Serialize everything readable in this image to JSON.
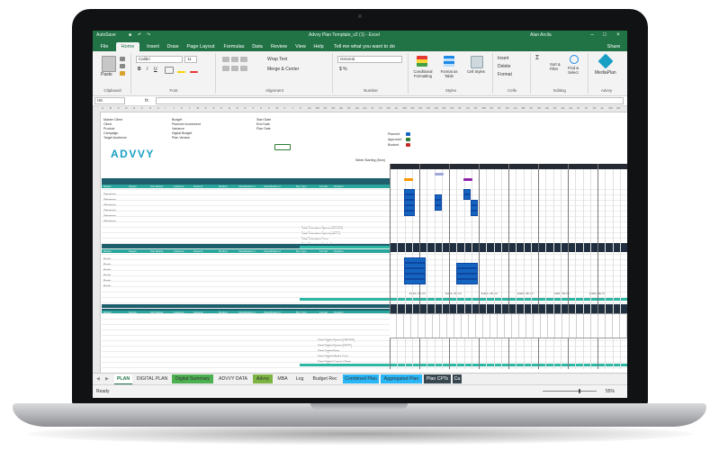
{
  "window": {
    "title": "Advvy Plan Template_v2 (1) - Excel",
    "user": "Alan Arcila",
    "autosave": "AutoSave"
  },
  "tabs": [
    "File",
    "Home",
    "Insert",
    "Draw",
    "Page Layout",
    "Formulas",
    "Data",
    "Review",
    "View",
    "Help",
    "Tell me what you want to do"
  ],
  "share": "Share",
  "ribbon": {
    "clipboard": {
      "paste": "Paste",
      "label": "Clipboard"
    },
    "font": {
      "name": "Calibri",
      "size": "11",
      "label": "Font"
    },
    "alignment": {
      "wrap": "Wrap Text",
      "merge": "Merge & Center",
      "label": "Alignment"
    },
    "number": {
      "format": "General",
      "label": "Number"
    },
    "styles": {
      "conditional": "Conditional Formatting",
      "table": "Format as Table",
      "cell": "Cell Styles",
      "label": "Styles"
    },
    "cells": {
      "insert": "Insert",
      "delete": "Delete",
      "format": "Format",
      "label": "Cells"
    },
    "editing": {
      "sort": "Sort & Filter",
      "find": "Find & Select",
      "label": "Editing"
    },
    "advvy": {
      "media": "MediaPlan",
      "label": "Advvy"
    }
  },
  "formula_bar": {
    "cell_ref": "H8",
    "fx": "fx",
    "value": ""
  },
  "sheet": {
    "logo": "ADVVY",
    "info_labels": [
      "Master Client",
      "Client",
      "Product",
      "Campaign",
      "Target Audience"
    ],
    "budget_labels": [
      "Budget",
      "Planned Investment",
      "Variance",
      "Digital Budget",
      "Plan Version"
    ],
    "date_labels": [
      "Start Date",
      "End Date",
      "Plan Date"
    ],
    "legend": [
      "Planned",
      "Approved",
      "Booked"
    ],
    "week_label": "Week Starting (Mon)",
    "sections": [
      "Network",
      "Radio",
      "OOH",
      "Digital"
    ],
    "col_headers": [
      "Market",
      "Region",
      "Sub Market",
      "Audience",
      "Network",
      "Medium",
      "Classification 1",
      "Classification 2",
      "Buy Type",
      "Format",
      "Duration"
    ],
    "rows_a": [
      "Television",
      "Television",
      "Television",
      "Television",
      "Television",
      "Television"
    ],
    "rows_b": [
      "Radio",
      "Radio",
      "Radio",
      "Radio",
      "Radio",
      "Radio"
    ],
    "totals": [
      "Total Television Spend (GROSS)",
      "Total Television Spend (NETT)",
      "Total Television Fees",
      "Total Television Media Cost",
      "Total Television Cost to Client"
    ],
    "totals_c": [
      "Total Digital Spend (GROSS)",
      "Total Digital Spend (NETT)",
      "Total Digital Fees",
      "Total Digital Media Cost",
      "Total Digital Cost to Client"
    ],
    "money": "$345,750.00"
  },
  "sheet_tabs": [
    {
      "label": "PLAN",
      "active": true,
      "color": "#ffffff"
    },
    {
      "label": "DIGITAL PLAN",
      "active": false,
      "color": "#f0f0f0"
    },
    {
      "label": "Digital Summary",
      "active": false,
      "color": "#4caf50"
    },
    {
      "label": "ADVVY DATA",
      "active": false,
      "color": "#f0f0f0"
    },
    {
      "label": "Advvy",
      "active": false,
      "color": "#7cb342"
    },
    {
      "label": "MBA",
      "active": false,
      "color": "#f0f0f0"
    },
    {
      "label": "Log",
      "active": false,
      "color": "#f0f0f0"
    },
    {
      "label": "Budget Rec",
      "active": false,
      "color": "#f0f0f0"
    },
    {
      "label": "Combined Plan",
      "active": false,
      "color": "#29b6f6"
    },
    {
      "label": "Aggregated Plan",
      "active": false,
      "color": "#29b6f6"
    },
    {
      "label": "Plan CPTs",
      "active": false,
      "color": "#37474f"
    },
    {
      "label": "Ca",
      "active": false,
      "color": "#37474f"
    }
  ],
  "status": {
    "ready": "Ready",
    "zoom": "55%"
  }
}
